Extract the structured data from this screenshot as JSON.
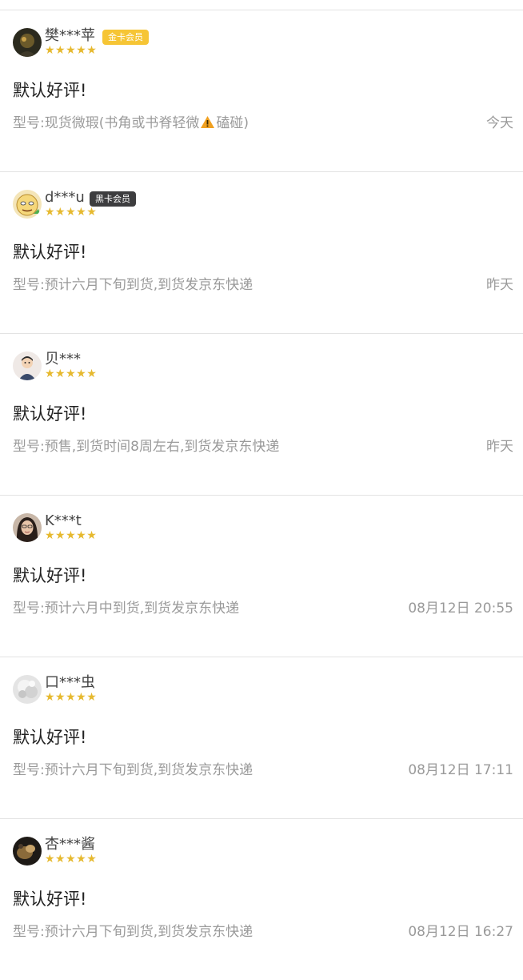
{
  "reviews": [
    {
      "user": "樊***苹",
      "badge": "金卡会员",
      "badge_type": "gold",
      "stars": "★★★★★",
      "content": "默认好评!",
      "spec_label": "型号:",
      "spec": "现货微瑕(书角或书脊轻微",
      "spec_icon": "warning-icon",
      "spec_after": "磕碰)",
      "date": "今天",
      "avatar": "portrait-dark-avatar"
    },
    {
      "user": "d***u",
      "badge": "黑卡会员",
      "badge_type": "black",
      "stars": "★★★★★",
      "content": "默认好评!",
      "spec_label": "型号:",
      "spec": "预计六月下旬到货,到货发京东快递",
      "date": "昨天",
      "avatar": "cartoon-face-avatar"
    },
    {
      "user": "贝***",
      "stars": "★★★★★",
      "content": "默认好评!",
      "spec_label": "型号:",
      "spec": "预售,到货时间8周左右,到货发京东快递",
      "date": "昨天",
      "avatar": "cartoon-person-avatar"
    },
    {
      "user": "K***t",
      "stars": "★★★★★",
      "content": "默认好评!",
      "spec_label": "型号:",
      "spec": "预计六月中到货,到货发京东快递",
      "date": "08月12日 20:55",
      "avatar": "woman-portrait-avatar"
    },
    {
      "user": "口***虫",
      "stars": "★★★★★",
      "content": "默认好评!",
      "spec_label": "型号:",
      "spec": "预计六月下旬到货,到货发京东快递",
      "date": "08月12日 17:11",
      "avatar": "white-texture-avatar"
    },
    {
      "user": "杏***酱",
      "stars": "★★★★★",
      "content": "默认好评!",
      "spec_label": "型号:",
      "spec": "预计六月下旬到货,到货发京东快递",
      "date": "08月12日 16:27",
      "avatar": "dark-photo-avatar"
    }
  ],
  "colors": {
    "star": "#e6b92f",
    "gold_badge": "#f6c535",
    "black_badge": "#3d3d3f",
    "muted_text": "#9a9a9a",
    "warning": "#f0a020"
  }
}
